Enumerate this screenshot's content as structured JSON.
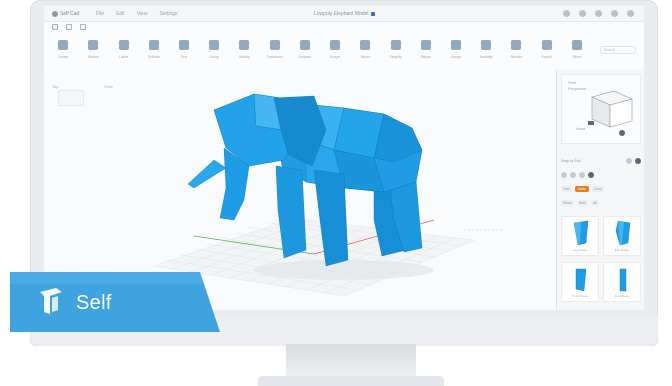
{
  "window": {
    "app_name": "Self Cad",
    "menus": [
      "File",
      "Edit",
      "View",
      "Settings"
    ],
    "file_name": "Lowpoly Elephant Model"
  },
  "toolbar": {
    "tools": [
      {
        "label": "Create",
        "icon": "cube-icon"
      },
      {
        "label": "Sketch",
        "icon": "pencil-icon"
      },
      {
        "label": "Lathe",
        "icon": "lathe-icon"
      },
      {
        "label": "Extrude",
        "icon": "extrude-icon"
      },
      {
        "label": "Text",
        "icon": "text-icon"
      },
      {
        "label": "Group",
        "icon": "group-icon"
      },
      {
        "label": "Modify",
        "icon": "modify-icon"
      },
      {
        "label": "Transform",
        "icon": "transform-icon"
      },
      {
        "label": "Boolean",
        "icon": "boolean-icon"
      },
      {
        "label": "Shape",
        "icon": "shape-icon"
      },
      {
        "label": "Mirror",
        "icon": "mirror-icon"
      },
      {
        "label": "Simplify",
        "icon": "simplify-icon"
      },
      {
        "label": "Repair",
        "icon": "repair-icon"
      },
      {
        "label": "Sculpt",
        "icon": "sculpt-icon"
      },
      {
        "label": "Animate",
        "icon": "animate-icon"
      },
      {
        "label": "Render",
        "icon": "render-icon"
      },
      {
        "label": "Export",
        "icon": "export-icon"
      },
      {
        "label": "Slicer",
        "icon": "slicer-icon"
      }
    ],
    "search_placeholder": "Search"
  },
  "right_panel": {
    "view_cube_caption": "Home",
    "view_label_top": "Front",
    "view_label_side": "Perspective",
    "row1_label": "Snap to Grid",
    "row2_items": [
      "Grid",
      "Units",
      "Color"
    ],
    "row3_items": [
      "Show",
      "Hide",
      "All"
    ],
    "thumbnails": [
      "Leg Shape",
      "Ear Shape",
      "Trunk Piece",
      "Foot Piece"
    ]
  },
  "viewport": {
    "corner_label_left": "Top",
    "corner_label_right": "View"
  },
  "badge": {
    "label": "Self"
  },
  "colors": {
    "model_blue": "#1e9ce6",
    "badge_blue": "#3fa3e0",
    "accent_orange": "#e67e22"
  }
}
